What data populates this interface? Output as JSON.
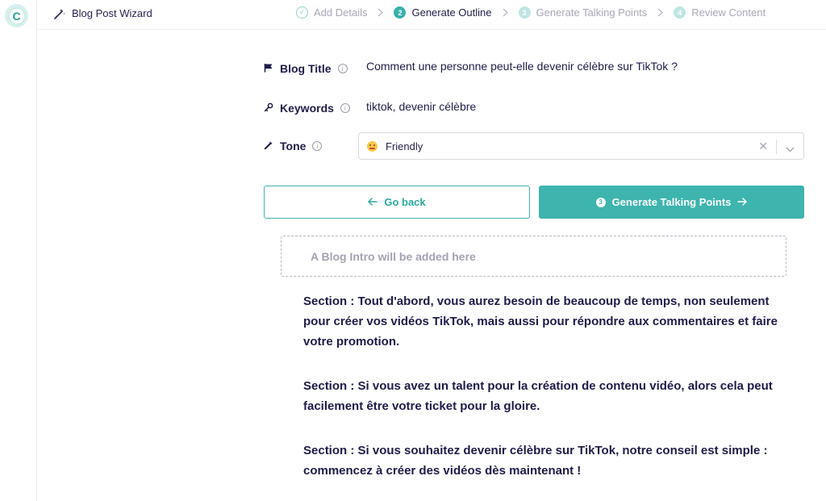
{
  "app": {
    "logo_letter": "C",
    "wizard_title": "Blog Post Wizard"
  },
  "steps": [
    {
      "num": "✓",
      "label": "Add Details",
      "state": "done"
    },
    {
      "num": "2",
      "label": "Generate Outline",
      "state": "current"
    },
    {
      "num": "3",
      "label": "Generate Talking Points",
      "state": "todo"
    },
    {
      "num": "4",
      "label": "Review Content",
      "state": "todo"
    }
  ],
  "fields": {
    "title_label": "Blog Title",
    "title_value": "Comment une personne peut-elle devenir célèbre sur TikTok ?",
    "keywords_label": "Keywords",
    "keywords_value": "tiktok, devenir célèbre",
    "tone_label": "Tone",
    "tone_value": "Friendly",
    "tone_emoji": "grinning-face-emoji"
  },
  "buttons": {
    "back_label": "Go back",
    "generate_label": "Generate Talking Points",
    "generate_step": "3"
  },
  "intro_placeholder": "A Blog Intro will be added here",
  "sections": [
    "Section : Tout d'abord, vous aurez besoin de beaucoup de temps, non seulement pour créer vos vidéos TikTok, mais aussi pour répondre aux commentaires et faire votre promotion.",
    "Section : Si vous avez un talent pour la création de contenu vidéo, alors cela peut facilement être votre ticket pour la gloire.",
    "Section : Si vous souhaitez devenir célèbre sur TikTok, notre conseil est simple : commencez à créer des vidéos dès maintenant !"
  ],
  "colors": {
    "accent": "#3db4ad",
    "text": "#1e1b4b",
    "muted": "#a8a8b8"
  }
}
